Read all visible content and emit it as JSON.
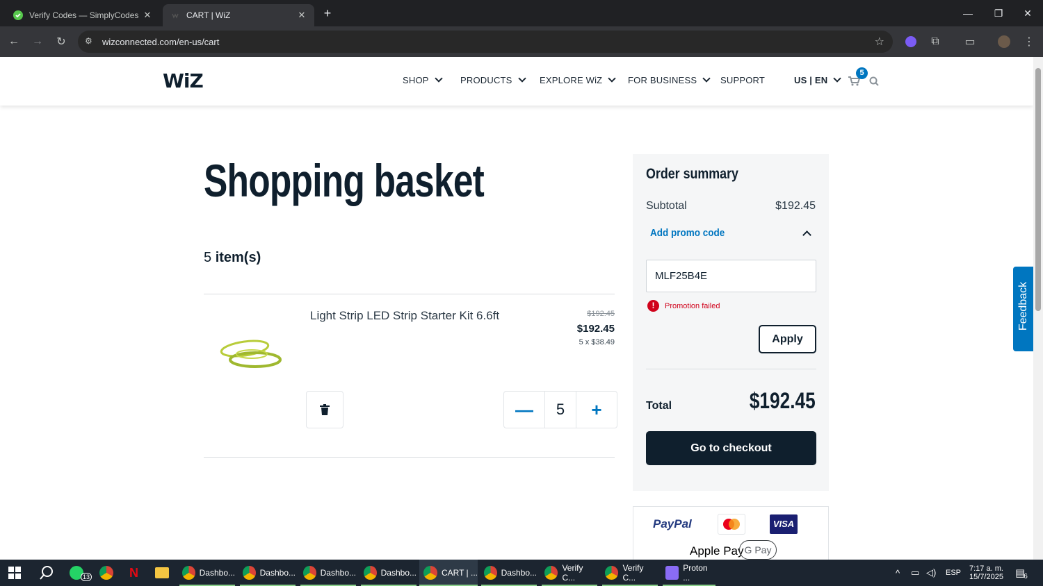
{
  "browser": {
    "tabs": [
      {
        "title": "Verify Codes — SimplyCodes",
        "active": false
      },
      {
        "title": "CART | WiZ",
        "active": true
      }
    ],
    "url": "wizconnected.com/en-us/cart"
  },
  "header": {
    "logo": "WiZ",
    "nav": [
      "SHOP",
      "PRODUCTS",
      "EXPLORE WiZ",
      "FOR BUSINESS",
      "SUPPORT"
    ],
    "lang": "US | EN",
    "cart_count": "5"
  },
  "basket": {
    "title": "Shopping basket",
    "count_num": "5",
    "count_label": "item(s)",
    "item": {
      "name": "Light Strip LED Strip Starter Kit 6.6ft",
      "old_price": "$192.45",
      "price": "$192.45",
      "unit": "5 x $38.49",
      "quantity": "5"
    }
  },
  "summary": {
    "title": "Order summary",
    "subtotal_label": "Subtotal",
    "subtotal_value": "$192.45",
    "promo_label": "Add promo code",
    "promo_value": "MLF25B4E",
    "promo_error": "Promotion failed",
    "apply_label": "Apply",
    "total_label": "Total",
    "total_value": "$192.45",
    "checkout_label": "Go to checkout"
  },
  "payments": [
    "PayPal",
    "Mastercard",
    "VISA",
    "Apple Pay",
    "G Pay"
  ],
  "feedback_label": "Feedback",
  "taskbar": {
    "apps": [
      {
        "label": "",
        "icon": "whatsapp-icon"
      },
      {
        "label": "",
        "icon": "chrome-icon"
      },
      {
        "label": "",
        "icon": "netflix-icon"
      },
      {
        "label": "",
        "icon": "folder-icon"
      },
      {
        "label": "Dashbo...",
        "icon": "chrome-icon"
      },
      {
        "label": "Dashbo...",
        "icon": "chrome-icon"
      },
      {
        "label": "Dashbo...",
        "icon": "chrome-icon"
      },
      {
        "label": "Dashbo...",
        "icon": "chrome-icon"
      },
      {
        "label": "CART | ...",
        "icon": "chrome-icon"
      },
      {
        "label": "Dashbo...",
        "icon": "chrome-icon"
      },
      {
        "label": "Verify C...",
        "icon": "chrome-icon"
      },
      {
        "label": "Verify C...",
        "icon": "chrome-icon"
      },
      {
        "label": "Proton ...",
        "icon": "proton-icon"
      }
    ],
    "whatsapp_badge": "13",
    "lang": "ESP",
    "time": "7:17 a. m.",
    "date": "15/7/2025",
    "notif_count": "6"
  }
}
